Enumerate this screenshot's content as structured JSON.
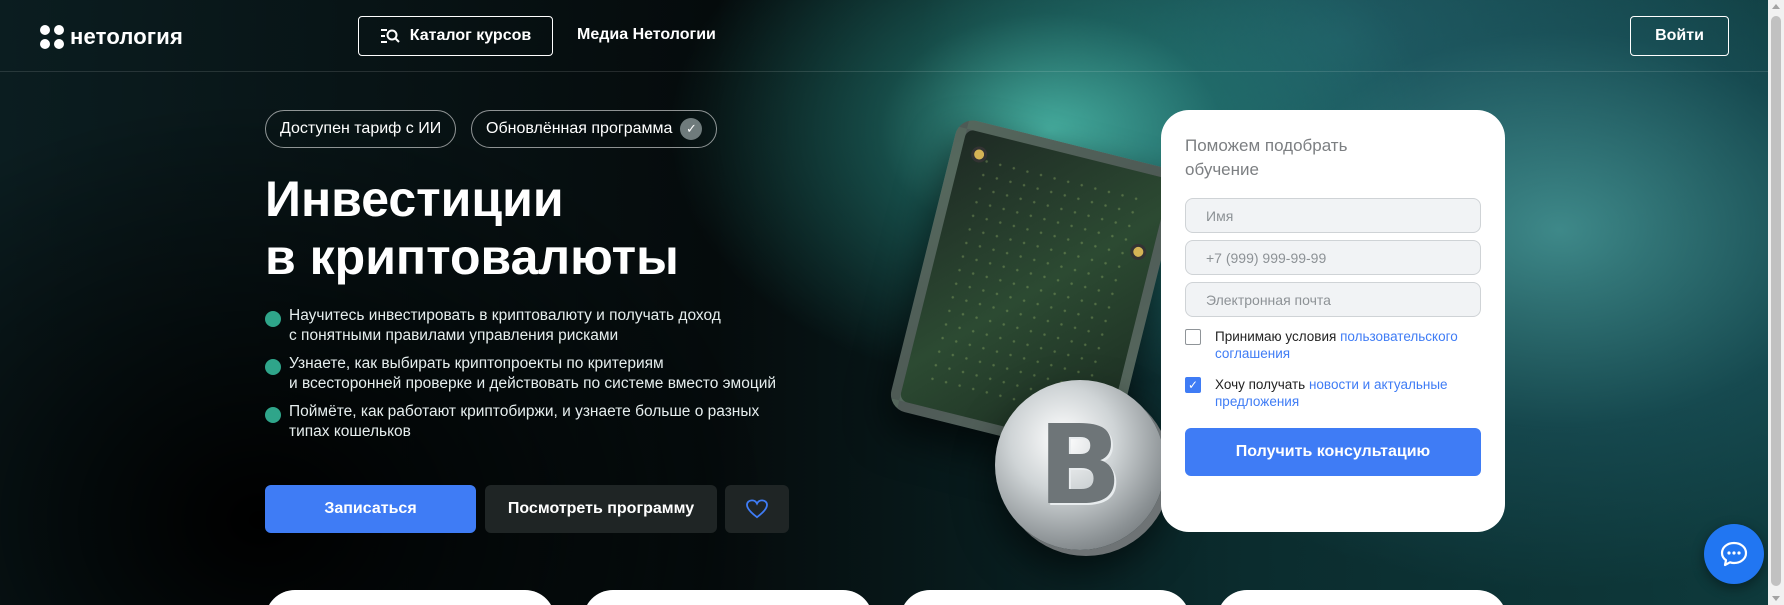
{
  "header": {
    "logo_text": "нетология",
    "catalog_label": "Каталог курсов",
    "media_label": "Медиа Нетологии",
    "login_label": "Войти"
  },
  "hero": {
    "tags": [
      "Доступен тариф с ИИ",
      "Обновлённая программа"
    ],
    "title_line1": "Инвестиции",
    "title_line2": "в криптовалюты",
    "bullets": [
      "Научитесь инвестировать в криптовалюту и получать доход\nс понятными правилами управления рисками",
      "Узнаете, как выбирать криптопроекты по критериям\nи всесторонней проверке и действовать по системе вместо эмоций",
      "Поймёте, как работают криптобиржи, и узнаете больше о разных\nтипах кошельков"
    ],
    "enroll_label": "Записаться",
    "program_label": "Посмотреть программу"
  },
  "illustration": {
    "coin_symbol": "B"
  },
  "form": {
    "title": "Поможем подобрать обучение",
    "name_placeholder": "Имя",
    "phone_placeholder": "+7 (999) 999-99-99",
    "email_placeholder": "Электронная почта",
    "terms_text": "Принимаю условия ",
    "terms_link": "пользовательского соглашения",
    "news_text": "Хочу получать ",
    "news_link": "новости и актуальные предложения",
    "submit_label": "Получить консультацию"
  },
  "icons": {
    "logo": "netology-logo-icon",
    "catalog": "catalog-search-icon",
    "verified": "verified-check-icon",
    "heart": "heart-icon",
    "chat": "chat-bubble-icon"
  },
  "colors": {
    "accent": "#3f7cf5",
    "bullet": "#2fa58a"
  }
}
